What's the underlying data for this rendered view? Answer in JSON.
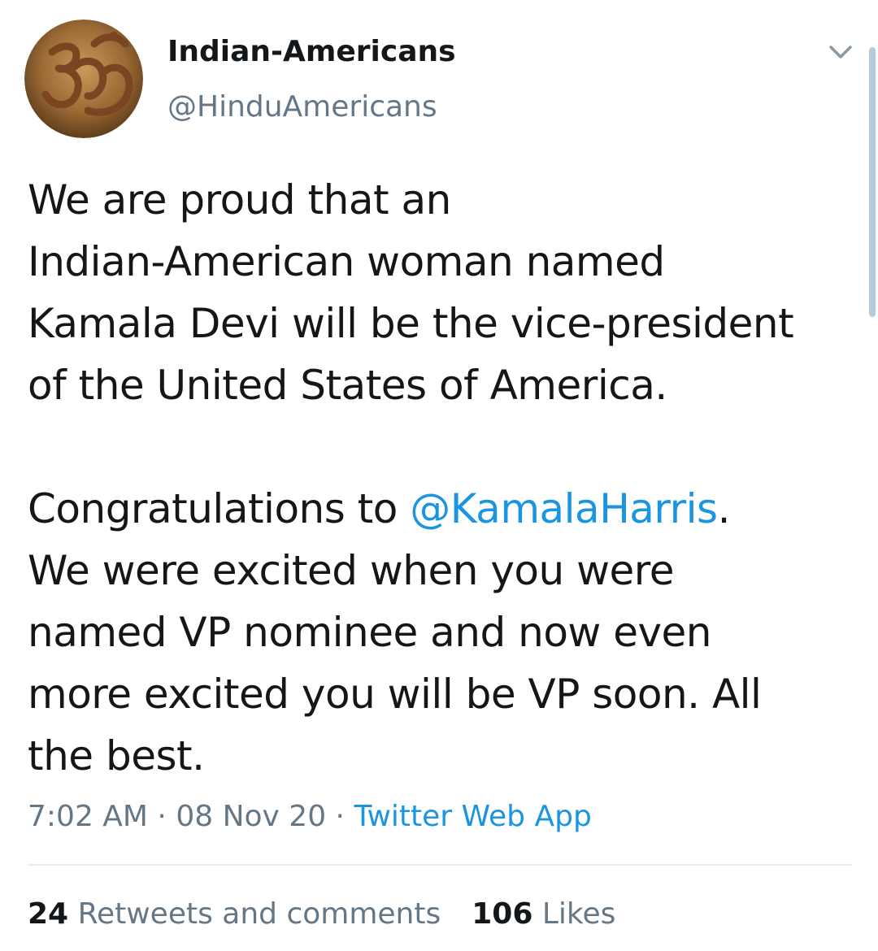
{
  "tweet": {
    "author": {
      "display_name": "Indian-Americans",
      "handle": "@HinduAmericans",
      "avatar_icon": "om-symbol-icon"
    },
    "menu_icon": "chevron-down-icon",
    "text": {
      "paragraph1_lines": [
        "We are proud that an",
        "Indian-American woman named",
        "Kamala Devi will be the vice-president",
        "of the United States of America."
      ],
      "paragraph2_line1_prefix": "Congratulations to ",
      "mention": "@KamalaHarris",
      "paragraph2_line1_suffix": ".",
      "paragraph2_lines": [
        "We were excited when you were",
        "named VP nominee and now even",
        "more excited you will be VP soon. All",
        "the best."
      ]
    },
    "meta": {
      "time": "7:02 AM",
      "separator": " · ",
      "date": "08 Nov 20",
      "source": "Twitter Web App"
    },
    "stats": {
      "retweets_count": "24",
      "retweets_label": "Retweets and comments",
      "likes_count": "106",
      "likes_label": "Likes"
    },
    "colors": {
      "link": "#1b95e0",
      "secondary_text": "#657786",
      "primary_text": "#14171a",
      "divider": "#e6ecf0"
    }
  }
}
